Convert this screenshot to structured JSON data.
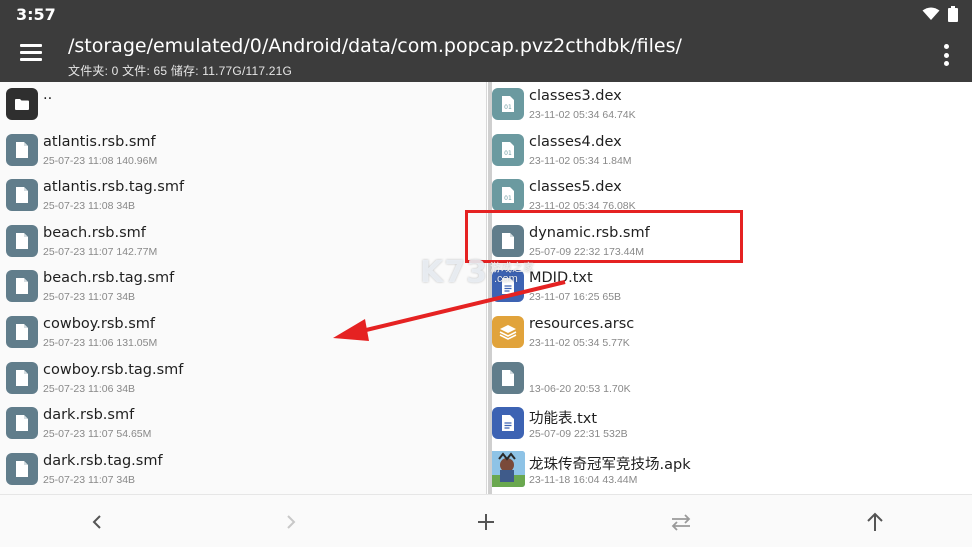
{
  "status": {
    "time": "3:57"
  },
  "header": {
    "path": "/storage/emulated/0/Android/data/com.popcap.pvz2cthdbk/files/",
    "summary": "文件夹: 0  文件: 65  储存: 11.77G/117.21G"
  },
  "left_pane": {
    "items": [
      {
        "name": "..",
        "meta": "",
        "icon": "folder-icon",
        "kind": "folder"
      },
      {
        "name": "atlantis.rsb.smf",
        "meta": "25-07-23 11:08  140.96M",
        "icon": "file-icon",
        "kind": "doc"
      },
      {
        "name": "atlantis.rsb.tag.smf",
        "meta": "25-07-23 11:08  34B",
        "icon": "file-icon",
        "kind": "doc"
      },
      {
        "name": "beach.rsb.smf",
        "meta": "25-07-23 11:07  142.77M",
        "icon": "file-icon",
        "kind": "doc"
      },
      {
        "name": "beach.rsb.tag.smf",
        "meta": "25-07-23 11:07  34B",
        "icon": "file-icon",
        "kind": "doc"
      },
      {
        "name": "cowboy.rsb.smf",
        "meta": "25-07-23 11:06  131.05M",
        "icon": "file-icon",
        "kind": "doc"
      },
      {
        "name": "cowboy.rsb.tag.smf",
        "meta": "25-07-23 11:06  34B",
        "icon": "file-icon",
        "kind": "doc"
      },
      {
        "name": "dark.rsb.smf",
        "meta": "25-07-23 11:07  54.65M",
        "icon": "file-icon",
        "kind": "doc"
      },
      {
        "name": "dark.rsb.tag.smf",
        "meta": "25-07-23 11:07  34B",
        "icon": "file-icon",
        "kind": "doc"
      }
    ]
  },
  "right_pane": {
    "items": [
      {
        "name": "classes3.dex",
        "meta": "23-11-02 05:34  64.74K",
        "icon": "binary-file-icon",
        "kind": "dex"
      },
      {
        "name": "classes4.dex",
        "meta": "23-11-02 05:34  1.84M",
        "icon": "binary-file-icon",
        "kind": "dex"
      },
      {
        "name": "classes5.dex",
        "meta": "23-11-02 05:34  76.08K",
        "icon": "binary-file-icon",
        "kind": "dex"
      },
      {
        "name": "dynamic.rsb.smf",
        "meta": "25-07-09 22:32  173.44M",
        "icon": "file-icon",
        "kind": "doc"
      },
      {
        "name": "MDID.txt",
        "meta": "23-11-07 16:25  65B",
        "icon": "text-file-icon",
        "kind": "txt"
      },
      {
        "name": "resources.arsc",
        "meta": "23-11-02 05:34  5.77K",
        "icon": "layers-icon",
        "kind": "arsc"
      },
      {
        "name": "",
        "meta": "13-06-20 20:53  1.70K",
        "icon": "file-icon",
        "kind": "doc"
      },
      {
        "name": "功能表.txt",
        "meta": "25-07-09 22:31  532B",
        "icon": "text-file-icon",
        "kind": "txt"
      },
      {
        "name": "龙珠传奇冠军竞技场.apk",
        "meta": "23-11-18 16:04  43.44M",
        "icon": "apk-thumbnail",
        "kind": "apk"
      }
    ]
  },
  "watermark": {
    "big": "K73",
    "small": "游戏之家",
    "dot": ".com"
  },
  "bottom_bar": {
    "back": "back-chevron-icon",
    "forward": "forward-chevron-icon",
    "add": "plus-icon",
    "swap": "swap-arrows-icon",
    "up": "up-arrow-icon"
  },
  "colors": {
    "header_bg": "#3c3c3c",
    "highlight": "#e52222",
    "doc_icon": "#617d8b",
    "dex_icon": "#6b9aa0",
    "txt_icon": "#3d63b3",
    "arsc_icon": "#e1a33b"
  }
}
